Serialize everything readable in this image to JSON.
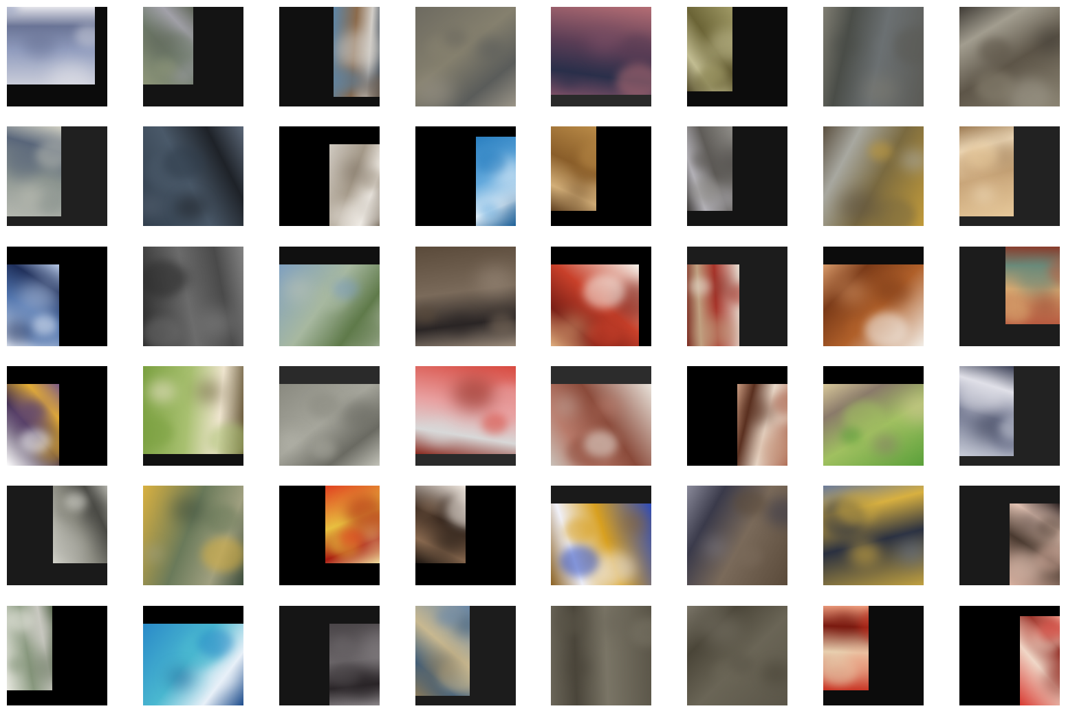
{
  "grid": {
    "rows": 6,
    "columns": 8,
    "tiles": [
      {
        "bg": "#0b0b0b",
        "crop": "top-left-3-4",
        "colors": [
          "#c9ccd9",
          "#8f9bbd",
          "#6a7496",
          "#e4e4ea"
        ]
      },
      {
        "bg": "#141414",
        "crop": "top-left-half",
        "colors": [
          "#8d9578",
          "#6e7a6a",
          "#a3a2aa",
          "#5f6658"
        ]
      },
      {
        "bg": "#101010",
        "crop": "top-right-half",
        "colors": [
          "#5d86a8",
          "#8c6b4c",
          "#d2cec8",
          "#3f4b58"
        ]
      },
      {
        "bg": "#333333",
        "crop": "full",
        "colors": [
          "#6d6a60",
          "#85806e",
          "#5a5c5a",
          "#9b9588"
        ]
      },
      {
        "bg": "#2a2a2a",
        "crop": "top-full",
        "colors": [
          "#b46d74",
          "#5a3d55",
          "#2a2f4a",
          "#7c4f66"
        ]
      },
      {
        "bg": "#0c0c0c",
        "crop": "left-narrow",
        "colors": [
          "#a09a66",
          "#6b6436",
          "#c2bd92",
          "#524a2b"
        ]
      },
      {
        "bg": "#2b2b2b",
        "crop": "full",
        "colors": [
          "#5a5a55",
          "#6b7072",
          "#4a4d48",
          "#7f7d72"
        ]
      },
      {
        "bg": "#3a3a3a",
        "crop": "full",
        "colors": [
          "#8a8372",
          "#5d5548",
          "#a29d8f",
          "#3f3b35"
        ]
      },
      {
        "bg": "#202020",
        "crop": "left-wide",
        "colors": [
          "#b5b8b0",
          "#8b948f",
          "#59667a",
          "#d0cfc2"
        ]
      },
      {
        "bg": "#1c1c1c",
        "crop": "full",
        "colors": [
          "#2f3c4a",
          "#4a5969",
          "#1e2228",
          "#5c6878"
        ]
      },
      {
        "bg": "#000000",
        "crop": "bottom-right-half",
        "colors": [
          "#cfc9c0",
          "#a59a8a",
          "#f0ece6",
          "#6f6355"
        ]
      },
      {
        "bg": "#000000",
        "crop": "right-narrow",
        "colors": [
          "#2a7fc0",
          "#63a9dc",
          "#e8f2fa",
          "#1b5e96"
        ]
      },
      {
        "bg": "#000000",
        "crop": "left-narrow",
        "colors": [
          "#b98a47",
          "#8a5e2a",
          "#d4b07a",
          "#5f4020"
        ]
      },
      {
        "bg": "#141414",
        "crop": "left-narrow",
        "colors": [
          "#8f8d88",
          "#5f5c58",
          "#b4b2b8",
          "#3e3b39"
        ]
      },
      {
        "bg": "#262626",
        "crop": "full",
        "colors": [
          "#c29b3a",
          "#7a6a40",
          "#a8a8a0",
          "#5b5040"
        ]
      },
      {
        "bg": "#222222",
        "crop": "left-wide",
        "colors": [
          "#e6c89a",
          "#c9a67a",
          "#f0dcbc",
          "#9c7a52"
        ]
      },
      {
        "bg": "#000000",
        "crop": "bottom-left-half",
        "colors": [
          "#e8eef8",
          "#4a6ea8",
          "#1f2f5a",
          "#b9cbe8"
        ]
      },
      {
        "bg": "#3a3a3a",
        "crop": "full",
        "colors": [
          "#2b2b2b",
          "#6b6b6b",
          "#4a4a4a",
          "#838383"
        ]
      },
      {
        "bg": "#101010",
        "crop": "bottom-full",
        "colors": [
          "#7fa0c0",
          "#a7b8a0",
          "#5f7a4a",
          "#c0c6b8"
        ]
      },
      {
        "bg": "#2c2c2c",
        "crop": "full",
        "colors": [
          "#5a4a3a",
          "#7a6a5a",
          "#2a2525",
          "#9a8a7a"
        ]
      },
      {
        "bg": "#000000",
        "crop": "bottom-left-3-4",
        "colors": [
          "#f4f1ea",
          "#c8402a",
          "#7a1f16",
          "#e0b080"
        ]
      },
      {
        "bg": "#1c1c1c",
        "crop": "bottom-left-half",
        "colors": [
          "#e8e0d4",
          "#a8342a",
          "#c0a080",
          "#7a2a20"
        ]
      },
      {
        "bg": "#0c0c0c",
        "crop": "bottom-full",
        "colors": [
          "#f2ede6",
          "#b0602a",
          "#7a3a18",
          "#d89a6a"
        ]
      },
      {
        "bg": "#1c1c1c",
        "crop": "right-wide",
        "colors": [
          "#b85a40",
          "#d8a870",
          "#6a8a7a",
          "#8a3a2a"
        ]
      },
      {
        "bg": "#000000",
        "crop": "bottom-left-half",
        "colors": [
          "#ffffff",
          "#3a2a4a",
          "#e8b030",
          "#7a5a8a"
        ]
      },
      {
        "bg": "#111111",
        "crop": "top-full",
        "colors": [
          "#7aa040",
          "#a8c070",
          "#f0e6d0",
          "#5a4a2a"
        ]
      },
      {
        "bg": "#2a2a2a",
        "crop": "bottom-full",
        "colors": [
          "#8a8a80",
          "#a6a69c",
          "#6a6a62",
          "#c2c2b8"
        ]
      },
      {
        "bg": "#2a2a2a",
        "crop": "top-full",
        "colors": [
          "#d84a40",
          "#e8a0a0",
          "#d8d8d8",
          "#8a2a20"
        ]
      },
      {
        "bg": "#2c2c2c",
        "crop": "bottom-full",
        "colors": [
          "#e8e2da",
          "#8a4a3a",
          "#b87a6a",
          "#c8c0b8"
        ]
      },
      {
        "bg": "#000000",
        "crop": "bottom-right-half",
        "colors": [
          "#a8604a",
          "#e8d8c8",
          "#5a3020",
          "#c89a80"
        ]
      },
      {
        "bg": "#000000",
        "crop": "bottom-full",
        "colors": [
          "#5aa03a",
          "#a0c060",
          "#8a7a6a",
          "#d8c89a"
        ]
      },
      {
        "bg": "#222222",
        "crop": "left-wide",
        "colors": [
          "#c8ccd8",
          "#6a708a",
          "#e0e0e8",
          "#3a3f55"
        ]
      },
      {
        "bg": "#1a1a1a",
        "crop": "right-wide",
        "colors": [
          "#d8d8d0",
          "#8a8a80",
          "#4a4a45",
          "#b0b0a8"
        ]
      },
      {
        "bg": "#3a3a3a",
        "crop": "full",
        "colors": [
          "#d8b040",
          "#6a7a5a",
          "#a0a080",
          "#3a4a3a"
        ]
      },
      {
        "bg": "#000000",
        "crop": "right-wide",
        "colors": [
          "#e04020",
          "#e8c040",
          "#a81a10",
          "#f0e0a0"
        ]
      },
      {
        "bg": "#000000",
        "crop": "top-left-half",
        "colors": [
          "#f0e8e0",
          "#3a2a20",
          "#8a6a50",
          "#1a1410"
        ]
      },
      {
        "bg": "#1a1a1a",
        "crop": "bottom-full",
        "colors": [
          "#2a4ac0",
          "#d8a020",
          "#f0f0f8",
          "#8a6020"
        ]
      },
      {
        "bg": "#2b2b2b",
        "crop": "full",
        "colors": [
          "#5a4a3a",
          "#7a6a5a",
          "#3a3a4a",
          "#8a8a9a"
        ]
      },
      {
        "bg": "#252525",
        "crop": "full",
        "colors": [
          "#c0a040",
          "#2a3040",
          "#d8b040",
          "#6a7a9a"
        ]
      },
      {
        "bg": "#1a1a1a",
        "crop": "bottom-right-half",
        "colors": [
          "#d8b0a0",
          "#4a3a30",
          "#e8c8b8",
          "#2a2020"
        ]
      },
      {
        "bg": "#000000",
        "crop": "left-narrow",
        "colors": [
          "#e8e8e0",
          "#8a9a80",
          "#c8c8c0",
          "#5a6a50"
        ]
      },
      {
        "bg": "#000000",
        "crop": "bottom-full",
        "colors": [
          "#2a8ac8",
          "#4ab8d0",
          "#e8f0f8",
          "#1a4a8a"
        ]
      },
      {
        "bg": "#151515",
        "crop": "bottom-right-half",
        "colors": [
          "#4a4548",
          "#6a6568",
          "#2a2528",
          "#8a8588"
        ]
      },
      {
        "bg": "#1c1c1c",
        "crop": "left-wide",
        "colors": [
          "#6a88a8",
          "#c8b890",
          "#3a5a7a",
          "#8a7a5a"
        ]
      },
      {
        "bg": "#3a3a3a",
        "crop": "full",
        "colors": [
          "#5a5548",
          "#7a7566",
          "#4a453a",
          "#6a6558"
        ]
      },
      {
        "bg": "#3a3a3a",
        "crop": "full",
        "colors": [
          "#5a5548",
          "#6a6556",
          "#4a4538",
          "#7a7568"
        ]
      },
      {
        "bg": "#0c0c0c",
        "crop": "left-narrow",
        "colors": [
          "#c83020",
          "#e8d0b0",
          "#7a1a10",
          "#f0a080"
        ]
      },
      {
        "bg": "#000000",
        "crop": "right-narrow",
        "colors": [
          "#d83830",
          "#f0d8c8",
          "#8a2018",
          "#f0a090"
        ]
      }
    ]
  }
}
